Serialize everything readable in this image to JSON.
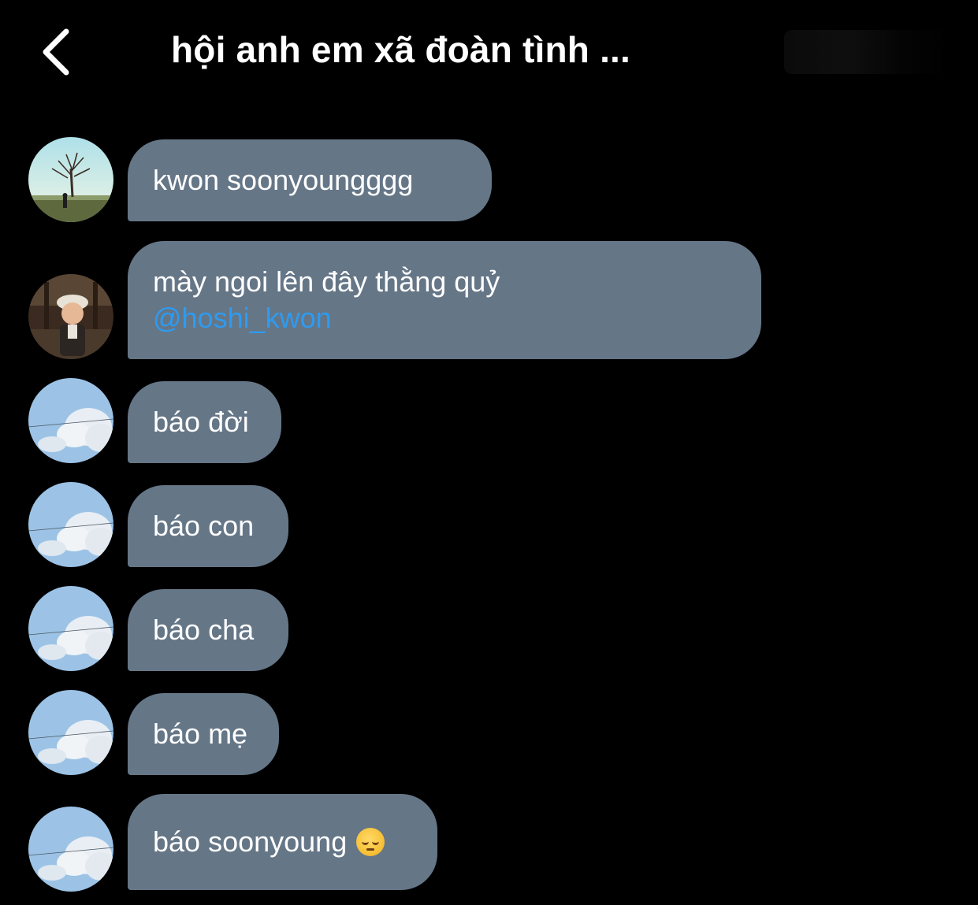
{
  "header": {
    "title": "hội anh em xã đoàn tình ...",
    "back_icon": "chevron-left-icon"
  },
  "colors": {
    "background": "#000000",
    "bubble": "#657687",
    "mention": "#2e9bf0",
    "text": "#ffffff"
  },
  "messages": [
    {
      "avatar": "tree-field-avatar",
      "text": "kwon soonyoungggg"
    },
    {
      "avatar": "child-cap-avatar",
      "text": "mày ngoi lên đây thằng quỷ",
      "mention": "@hoshi_kwon"
    },
    {
      "avatar": "cloud-sky-avatar",
      "text": "báo đời"
    },
    {
      "avatar": "cloud-sky-avatar",
      "text": "báo con"
    },
    {
      "avatar": "cloud-sky-avatar",
      "text": "báo cha"
    },
    {
      "avatar": "cloud-sky-avatar",
      "text": "báo mẹ"
    },
    {
      "avatar": "cloud-sky-avatar",
      "text": "báo soonyoung",
      "emoji": "pensive-face"
    }
  ]
}
